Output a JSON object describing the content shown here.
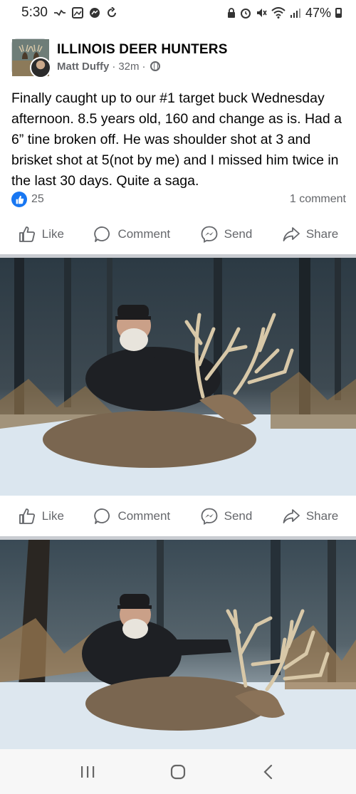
{
  "status_bar": {
    "time": "5:30",
    "battery": "47%"
  },
  "post": {
    "group_name": "ILLINOIS DEER HUNTERS",
    "author": "Matt Duffy",
    "timestamp": "32m",
    "separator": "·",
    "text": "Finally caught up to our #1 target buck Wednesday afternoon.  8.5 years old, 160 and change as is.  Had a 6” tine broken off.  He was shoulder shot at 3 and brisket shot at 5(not by me) and I missed him twice in the last 30 days.  Quite a saga.",
    "reaction_count": "25",
    "comment_count": "1 comment"
  },
  "actions": {
    "like": "Like",
    "comment": "Comment",
    "send": "Send",
    "share": "Share"
  },
  "colors": {
    "brand_blue": "#1877f2",
    "secondary_text": "#65676b",
    "divider": "#c9ccd1"
  },
  "icons": [
    "group-avatar",
    "user-avatar",
    "globe-icon",
    "like-icon",
    "comment-icon",
    "messenger-icon",
    "share-icon",
    "recent-apps-icon",
    "home-icon",
    "back-icon"
  ]
}
